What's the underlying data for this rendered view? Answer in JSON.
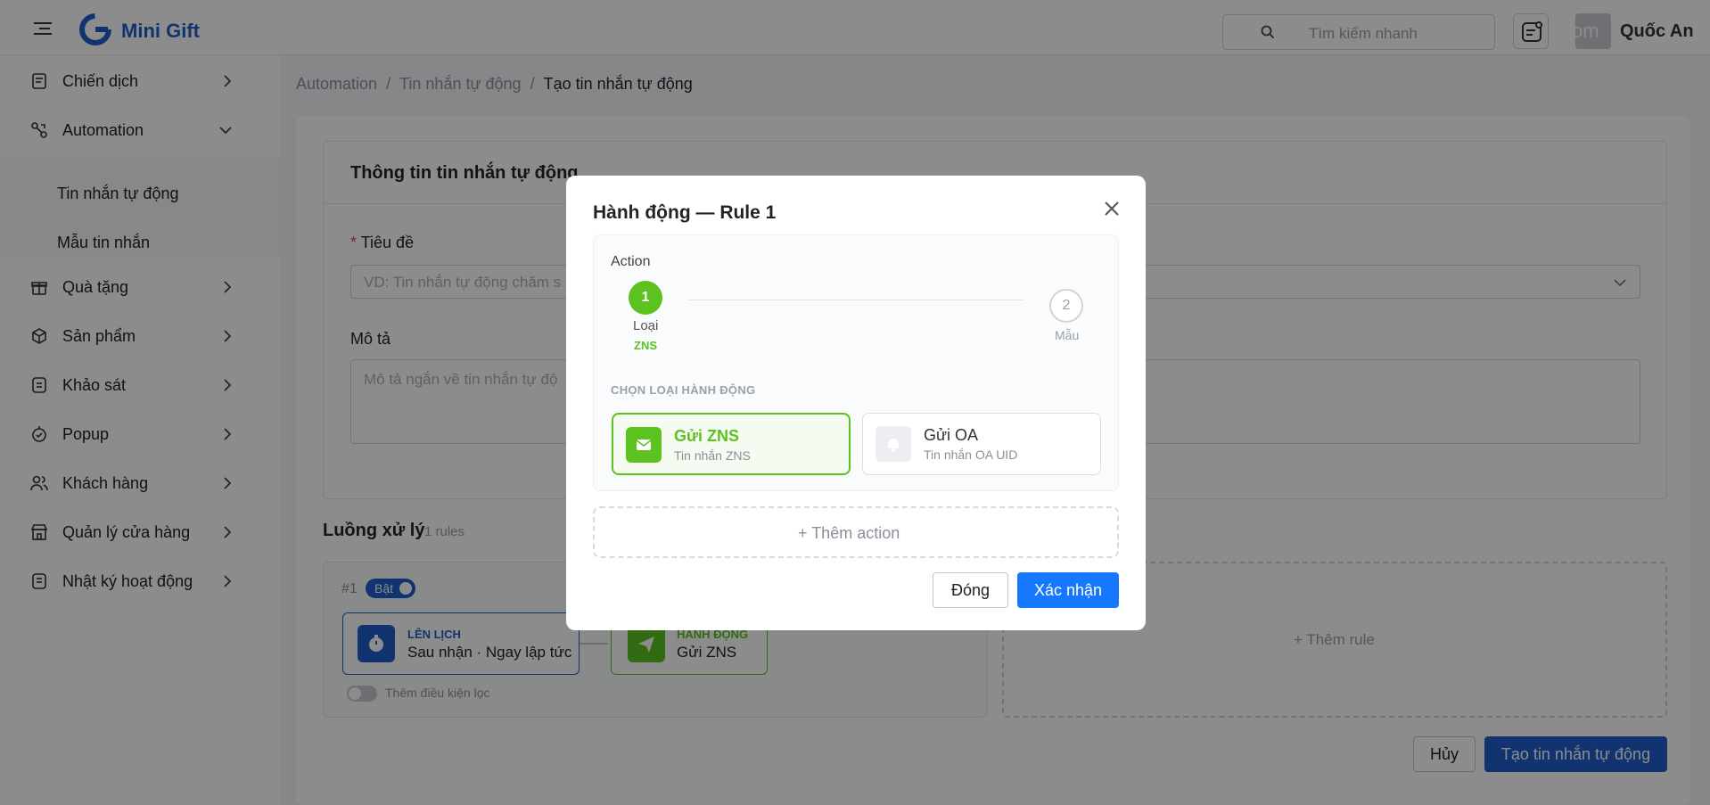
{
  "header": {
    "brand": "Mini Gift",
    "search_placeholder": "Tìm kiếm nhanh",
    "avatar_text": "om",
    "username": "Quốc An"
  },
  "sidebar": {
    "items": [
      {
        "label": "Chiến dịch"
      },
      {
        "label": "Automation"
      },
      {
        "label": "Quà tặng"
      },
      {
        "label": "Sản phẩm"
      },
      {
        "label": "Khảo sát"
      },
      {
        "label": "Popup"
      },
      {
        "label": "Khách hàng"
      },
      {
        "label": "Quản lý cửa hàng"
      },
      {
        "label": "Nhật ký hoạt động"
      }
    ],
    "subitems": [
      {
        "label": "Tin nhắn tự động"
      },
      {
        "label": "Mẫu tin nhắn"
      }
    ]
  },
  "breadcrumb": [
    "Automation",
    "Tin nhắn tự động",
    "Tạo tin nhắn tự động"
  ],
  "form": {
    "card_title": "Thông tin tin nhắn tự động",
    "title_required": "*",
    "title_label": "Tiêu đề",
    "title_placeholder": "VD: Tin nhắn tự động chăm s",
    "desc_label": "Mô tả",
    "desc_placeholder": "Mô tả ngắn về tin nhắn tự độ"
  },
  "flow": {
    "title": "Luồng xử lý",
    "count": "1 rules",
    "rule_num": "#1",
    "rule_toggle": "Bật",
    "schedule_kicker": "LÊN LỊCH",
    "schedule_value": "Sau nhận · Ngay lập tức",
    "action_kicker": "HÀNH ĐỘNG",
    "action_value": "Gửi ZNS",
    "filter_label": "Thêm điều kiện lọc",
    "add_rule": "+  Thêm rule"
  },
  "footer": {
    "cancel": "Hủy",
    "create": "Tạo tin nhắn tự động"
  },
  "modal": {
    "title": "Hành động — Rule 1",
    "action_label": "Action",
    "step1_num": "1",
    "step1_label": "Loại",
    "step1_sub": "ZNS",
    "step2_num": "2",
    "step2_label": "Mẫu",
    "section": "CHỌN LOẠI HÀNH ĐỘNG",
    "options": [
      {
        "name": "Gửi ZNS",
        "sub": "Tin nhắn ZNS",
        "selected": true
      },
      {
        "name": "Gửi OA",
        "sub": "Tin nhắn OA UID",
        "selected": false
      }
    ],
    "add_action": "+  Thêm action",
    "close_btn": "Đóng",
    "confirm_btn": "Xác nhận"
  },
  "colors": {
    "primary": "#1f5fcc",
    "modal_primary": "#1677ff",
    "success": "#5bc21f"
  }
}
